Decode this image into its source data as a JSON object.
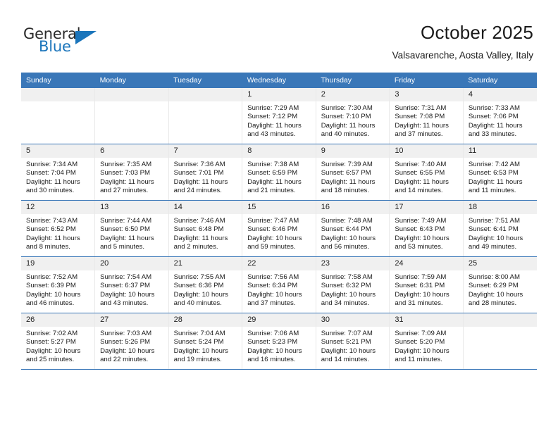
{
  "logo": {
    "word_top": "General",
    "word_bottom": "Blue",
    "shape": "triangle-icon"
  },
  "header": {
    "month_title": "October 2025",
    "location": "Valsavarenche, Aosta Valley, Italy"
  },
  "colors": {
    "header_blue": "#3a77b8",
    "logo_blue": "#1b75bb",
    "daynum_bg": "#f0f0f0",
    "cell_bg": "#ffffff"
  },
  "weekday_headers": [
    "Sunday",
    "Monday",
    "Tuesday",
    "Wednesday",
    "Thursday",
    "Friday",
    "Saturday"
  ],
  "labels": {
    "sunrise_prefix": "Sunrise:",
    "sunset_prefix": "Sunset:",
    "daylight_prefix": "Daylight:"
  },
  "weeks": [
    [
      {
        "day": "",
        "empty": true
      },
      {
        "day": "",
        "empty": true
      },
      {
        "day": "",
        "empty": true
      },
      {
        "day": "1",
        "sunrise": "Sunrise: 7:29 AM",
        "sunset": "Sunset: 7:12 PM",
        "daylight1": "Daylight: 11 hours",
        "daylight2": "and 43 minutes."
      },
      {
        "day": "2",
        "sunrise": "Sunrise: 7:30 AM",
        "sunset": "Sunset: 7:10 PM",
        "daylight1": "Daylight: 11 hours",
        "daylight2": "and 40 minutes."
      },
      {
        "day": "3",
        "sunrise": "Sunrise: 7:31 AM",
        "sunset": "Sunset: 7:08 PM",
        "daylight1": "Daylight: 11 hours",
        "daylight2": "and 37 minutes."
      },
      {
        "day": "4",
        "sunrise": "Sunrise: 7:33 AM",
        "sunset": "Sunset: 7:06 PM",
        "daylight1": "Daylight: 11 hours",
        "daylight2": "and 33 minutes."
      }
    ],
    [
      {
        "day": "5",
        "sunrise": "Sunrise: 7:34 AM",
        "sunset": "Sunset: 7:04 PM",
        "daylight1": "Daylight: 11 hours",
        "daylight2": "and 30 minutes."
      },
      {
        "day": "6",
        "sunrise": "Sunrise: 7:35 AM",
        "sunset": "Sunset: 7:03 PM",
        "daylight1": "Daylight: 11 hours",
        "daylight2": "and 27 minutes."
      },
      {
        "day": "7",
        "sunrise": "Sunrise: 7:36 AM",
        "sunset": "Sunset: 7:01 PM",
        "daylight1": "Daylight: 11 hours",
        "daylight2": "and 24 minutes."
      },
      {
        "day": "8",
        "sunrise": "Sunrise: 7:38 AM",
        "sunset": "Sunset: 6:59 PM",
        "daylight1": "Daylight: 11 hours",
        "daylight2": "and 21 minutes."
      },
      {
        "day": "9",
        "sunrise": "Sunrise: 7:39 AM",
        "sunset": "Sunset: 6:57 PM",
        "daylight1": "Daylight: 11 hours",
        "daylight2": "and 18 minutes."
      },
      {
        "day": "10",
        "sunrise": "Sunrise: 7:40 AM",
        "sunset": "Sunset: 6:55 PM",
        "daylight1": "Daylight: 11 hours",
        "daylight2": "and 14 minutes."
      },
      {
        "day": "11",
        "sunrise": "Sunrise: 7:42 AM",
        "sunset": "Sunset: 6:53 PM",
        "daylight1": "Daylight: 11 hours",
        "daylight2": "and 11 minutes."
      }
    ],
    [
      {
        "day": "12",
        "sunrise": "Sunrise: 7:43 AM",
        "sunset": "Sunset: 6:52 PM",
        "daylight1": "Daylight: 11 hours",
        "daylight2": "and 8 minutes."
      },
      {
        "day": "13",
        "sunrise": "Sunrise: 7:44 AM",
        "sunset": "Sunset: 6:50 PM",
        "daylight1": "Daylight: 11 hours",
        "daylight2": "and 5 minutes."
      },
      {
        "day": "14",
        "sunrise": "Sunrise: 7:46 AM",
        "sunset": "Sunset: 6:48 PM",
        "daylight1": "Daylight: 11 hours",
        "daylight2": "and 2 minutes."
      },
      {
        "day": "15",
        "sunrise": "Sunrise: 7:47 AM",
        "sunset": "Sunset: 6:46 PM",
        "daylight1": "Daylight: 10 hours",
        "daylight2": "and 59 minutes."
      },
      {
        "day": "16",
        "sunrise": "Sunrise: 7:48 AM",
        "sunset": "Sunset: 6:44 PM",
        "daylight1": "Daylight: 10 hours",
        "daylight2": "and 56 minutes."
      },
      {
        "day": "17",
        "sunrise": "Sunrise: 7:49 AM",
        "sunset": "Sunset: 6:43 PM",
        "daylight1": "Daylight: 10 hours",
        "daylight2": "and 53 minutes."
      },
      {
        "day": "18",
        "sunrise": "Sunrise: 7:51 AM",
        "sunset": "Sunset: 6:41 PM",
        "daylight1": "Daylight: 10 hours",
        "daylight2": "and 49 minutes."
      }
    ],
    [
      {
        "day": "19",
        "sunrise": "Sunrise: 7:52 AM",
        "sunset": "Sunset: 6:39 PM",
        "daylight1": "Daylight: 10 hours",
        "daylight2": "and 46 minutes."
      },
      {
        "day": "20",
        "sunrise": "Sunrise: 7:54 AM",
        "sunset": "Sunset: 6:37 PM",
        "daylight1": "Daylight: 10 hours",
        "daylight2": "and 43 minutes."
      },
      {
        "day": "21",
        "sunrise": "Sunrise: 7:55 AM",
        "sunset": "Sunset: 6:36 PM",
        "daylight1": "Daylight: 10 hours",
        "daylight2": "and 40 minutes."
      },
      {
        "day": "22",
        "sunrise": "Sunrise: 7:56 AM",
        "sunset": "Sunset: 6:34 PM",
        "daylight1": "Daylight: 10 hours",
        "daylight2": "and 37 minutes."
      },
      {
        "day": "23",
        "sunrise": "Sunrise: 7:58 AM",
        "sunset": "Sunset: 6:32 PM",
        "daylight1": "Daylight: 10 hours",
        "daylight2": "and 34 minutes."
      },
      {
        "day": "24",
        "sunrise": "Sunrise: 7:59 AM",
        "sunset": "Sunset: 6:31 PM",
        "daylight1": "Daylight: 10 hours",
        "daylight2": "and 31 minutes."
      },
      {
        "day": "25",
        "sunrise": "Sunrise: 8:00 AM",
        "sunset": "Sunset: 6:29 PM",
        "daylight1": "Daylight: 10 hours",
        "daylight2": "and 28 minutes."
      }
    ],
    [
      {
        "day": "26",
        "sunrise": "Sunrise: 7:02 AM",
        "sunset": "Sunset: 5:27 PM",
        "daylight1": "Daylight: 10 hours",
        "daylight2": "and 25 minutes."
      },
      {
        "day": "27",
        "sunrise": "Sunrise: 7:03 AM",
        "sunset": "Sunset: 5:26 PM",
        "daylight1": "Daylight: 10 hours",
        "daylight2": "and 22 minutes."
      },
      {
        "day": "28",
        "sunrise": "Sunrise: 7:04 AM",
        "sunset": "Sunset: 5:24 PM",
        "daylight1": "Daylight: 10 hours",
        "daylight2": "and 19 minutes."
      },
      {
        "day": "29",
        "sunrise": "Sunrise: 7:06 AM",
        "sunset": "Sunset: 5:23 PM",
        "daylight1": "Daylight: 10 hours",
        "daylight2": "and 16 minutes."
      },
      {
        "day": "30",
        "sunrise": "Sunrise: 7:07 AM",
        "sunset": "Sunset: 5:21 PM",
        "daylight1": "Daylight: 10 hours",
        "daylight2": "and 14 minutes."
      },
      {
        "day": "31",
        "sunrise": "Sunrise: 7:09 AM",
        "sunset": "Sunset: 5:20 PM",
        "daylight1": "Daylight: 10 hours",
        "daylight2": "and 11 minutes."
      },
      {
        "day": "",
        "empty": true
      }
    ]
  ]
}
